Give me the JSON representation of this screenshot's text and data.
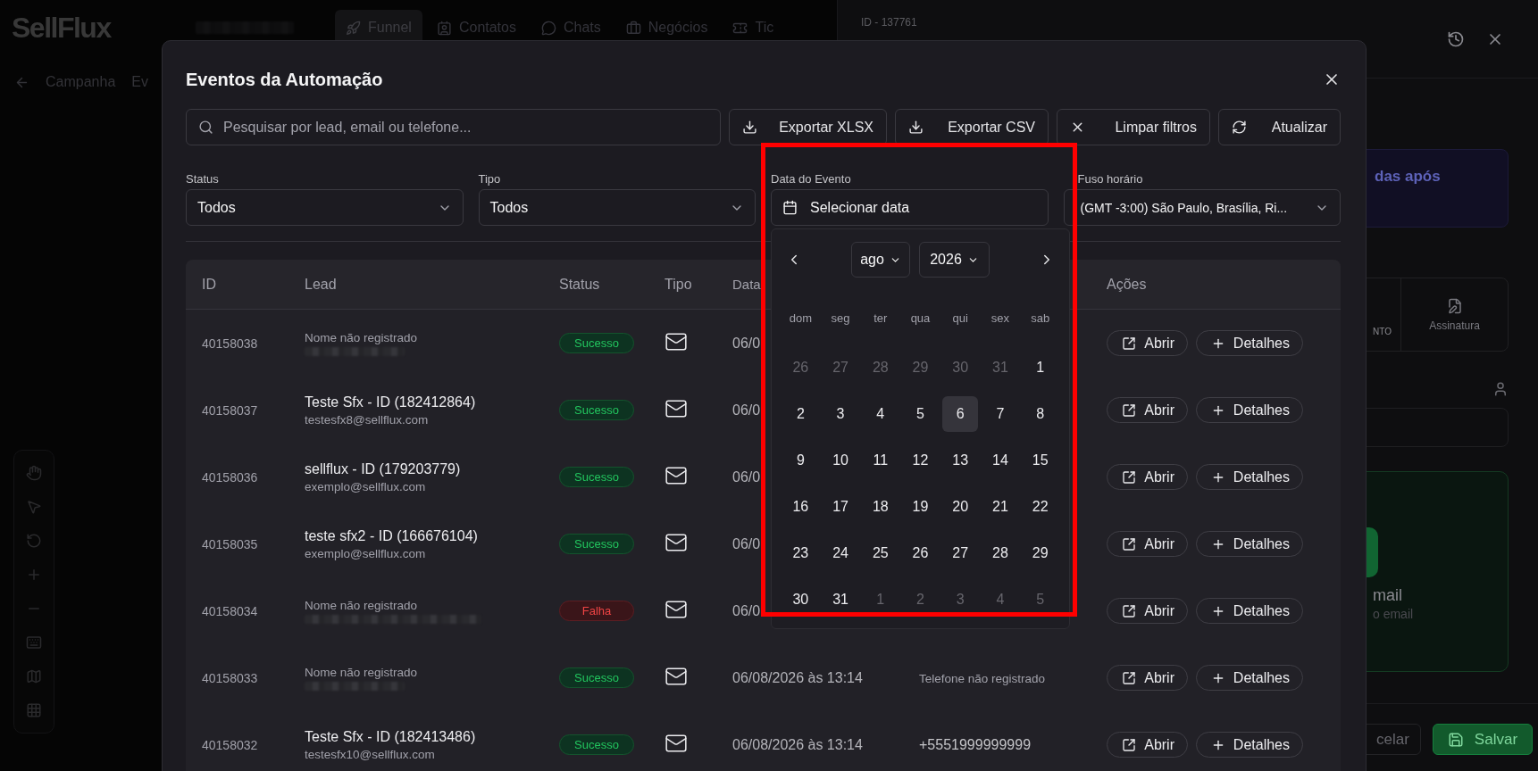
{
  "app": {
    "logo": "SellFlux",
    "nav": [
      {
        "label": "Funnel",
        "selected": true
      },
      {
        "label": "Contatos",
        "selected": false
      },
      {
        "label": "Chats",
        "selected": false
      },
      {
        "label": "Negócios",
        "selected": false
      },
      {
        "label": "Tic",
        "selected": false
      }
    ],
    "breadcrumb": [
      "Campanha",
      "Ev"
    ]
  },
  "drawer": {
    "title": "ID - 137761",
    "notice": "das após",
    "option_fragment": "NTO",
    "option": "Assinatura",
    "email_card": {
      "title": "mail",
      "subtitle": "o email"
    },
    "buttons": [
      {
        "kind": "cancel",
        "label": "celar"
      },
      {
        "kind": "save",
        "label": "Salvar"
      }
    ]
  },
  "modal": {
    "title": "Eventos da Automação",
    "search": {
      "placeholder": "Pesquisar por lead, email ou telefone..."
    },
    "actions": [
      {
        "kind": "download",
        "label": "Exportar XLSX"
      },
      {
        "kind": "download",
        "label": "Exportar CSV"
      },
      {
        "kind": "clear",
        "label": "Limpar filtros"
      },
      {
        "kind": "refresh",
        "label": "Atualizar"
      }
    ],
    "filters": [
      {
        "kind": "select",
        "label": "Status",
        "value": "Todos"
      },
      {
        "kind": "select",
        "label": "Tipo",
        "value": "Todos"
      },
      {
        "kind": "date",
        "label": "Data do Evento",
        "placeholder": "Selecionar data"
      },
      {
        "kind": "select",
        "label": "Fuso horário",
        "value": "(GMT -3:00) São Paulo, Brasília, Ri..."
      }
    ],
    "calendar": {
      "month": "ago",
      "year": "2026",
      "weekdays": [
        "dom",
        "seg",
        "ter",
        "qua",
        "qui",
        "sex",
        "sab"
      ],
      "weeks": [
        [
          {
            "day": "26",
            "outside": true,
            "selected": false
          },
          {
            "day": "27",
            "outside": true,
            "selected": false
          },
          {
            "day": "28",
            "outside": true,
            "selected": false
          },
          {
            "day": "29",
            "outside": true,
            "selected": false
          },
          {
            "day": "30",
            "outside": true,
            "selected": false
          },
          {
            "day": "31",
            "outside": true,
            "selected": false
          },
          {
            "day": "1",
            "outside": false,
            "selected": false
          }
        ],
        [
          {
            "day": "2",
            "outside": false,
            "selected": false
          },
          {
            "day": "3",
            "outside": false,
            "selected": false
          },
          {
            "day": "4",
            "outside": false,
            "selected": false
          },
          {
            "day": "5",
            "outside": false,
            "selected": false
          },
          {
            "day": "6",
            "outside": false,
            "selected": true
          },
          {
            "day": "7",
            "outside": false,
            "selected": false
          },
          {
            "day": "8",
            "outside": false,
            "selected": false
          }
        ],
        [
          {
            "day": "9",
            "outside": false,
            "selected": false
          },
          {
            "day": "10",
            "outside": false,
            "selected": false
          },
          {
            "day": "11",
            "outside": false,
            "selected": false
          },
          {
            "day": "12",
            "outside": false,
            "selected": false
          },
          {
            "day": "13",
            "outside": false,
            "selected": false
          },
          {
            "day": "14",
            "outside": false,
            "selected": false
          },
          {
            "day": "15",
            "outside": false,
            "selected": false
          }
        ],
        [
          {
            "day": "16",
            "outside": false,
            "selected": false
          },
          {
            "day": "17",
            "outside": false,
            "selected": false
          },
          {
            "day": "18",
            "outside": false,
            "selected": false
          },
          {
            "day": "19",
            "outside": false,
            "selected": false
          },
          {
            "day": "20",
            "outside": false,
            "selected": false
          },
          {
            "day": "21",
            "outside": false,
            "selected": false
          },
          {
            "day": "22",
            "outside": false,
            "selected": false
          }
        ],
        [
          {
            "day": "23",
            "outside": false,
            "selected": false
          },
          {
            "day": "24",
            "outside": false,
            "selected": false
          },
          {
            "day": "25",
            "outside": false,
            "selected": false
          },
          {
            "day": "26",
            "outside": false,
            "selected": false
          },
          {
            "day": "27",
            "outside": false,
            "selected": false
          },
          {
            "day": "28",
            "outside": false,
            "selected": false
          },
          {
            "day": "29",
            "outside": false,
            "selected": false
          }
        ],
        [
          {
            "day": "30",
            "outside": false,
            "selected": false
          },
          {
            "day": "31",
            "outside": false,
            "selected": false
          },
          {
            "day": "1",
            "outside": true,
            "selected": false
          },
          {
            "day": "2",
            "outside": true,
            "selected": false
          },
          {
            "day": "3",
            "outside": true,
            "selected": false
          },
          {
            "day": "4",
            "outside": true,
            "selected": false
          },
          {
            "day": "5",
            "outside": true,
            "selected": false
          }
        ]
      ]
    },
    "table": {
      "columns": [
        {
          "kind": "id",
          "label": "ID"
        },
        {
          "kind": "lead",
          "label": "Lead"
        },
        {
          "kind": "status",
          "label": "Status"
        },
        {
          "kind": "type",
          "label": "Tipo"
        },
        {
          "kind": "date",
          "label": "Data"
        },
        {
          "kind": "actions",
          "label": "Ações"
        }
      ],
      "rows": [
        {
          "id": "40158038",
          "lead": {
            "kind": "placeholder",
            "name": "Nome não registrado",
            "email_hidden": true
          },
          "status": {
            "kind": "success",
            "label": "Sucesso"
          },
          "type": {
            "kind": "email"
          },
          "date": "06/0",
          "actions": [
            "Abrir",
            "Detalhes"
          ]
        },
        {
          "id": "40158037",
          "lead": {
            "kind": "name",
            "name": "Teste Sfx - ID (182412864)",
            "email": "testesfx8@sellflux.com"
          },
          "status": {
            "kind": "success",
            "label": "Sucesso"
          },
          "type": {
            "kind": "email"
          },
          "date": "06/0",
          "actions": [
            "Abrir",
            "Detalhes"
          ]
        },
        {
          "id": "40158036",
          "lead": {
            "kind": "name",
            "name": "sellflux - ID (179203779)",
            "email": "exemplo@sellflux.com"
          },
          "status": {
            "kind": "success",
            "label": "Sucesso"
          },
          "type": {
            "kind": "email"
          },
          "date": "06/0",
          "actions": [
            "Abrir",
            "Detalhes"
          ]
        },
        {
          "id": "40158035",
          "lead": {
            "kind": "name",
            "name": "teste sfx2 - ID (166676104)",
            "email": "exemplo@sellflux.com"
          },
          "status": {
            "kind": "success",
            "label": "Sucesso"
          },
          "type": {
            "kind": "email"
          },
          "date": "06/0",
          "actions": [
            "Abrir",
            "Detalhes"
          ]
        },
        {
          "id": "40158034",
          "lead": {
            "kind": "placeholder",
            "name": "Nome não registrado",
            "email_hidden": true
          },
          "status": {
            "kind": "failure",
            "label": "Falha"
          },
          "type": {
            "kind": "email"
          },
          "date": "06/0",
          "actions": [
            "Abrir",
            "Detalhes"
          ]
        },
        {
          "id": "40158033",
          "lead": {
            "kind": "placeholder",
            "name": "Nome não registrado",
            "email_hidden": true
          },
          "status": {
            "kind": "success",
            "label": "Sucesso"
          },
          "type": {
            "kind": "email"
          },
          "date": "06/08/2026 às 13:14",
          "phone": {
            "kind": "placeholder",
            "text": "Telefone não registrado"
          },
          "actions": [
            "Abrir",
            "Detalhes"
          ]
        },
        {
          "id": "40158032",
          "lead": {
            "kind": "name",
            "name": "Teste Sfx - ID (182413486)",
            "email": "testesfx10@sellflux.com"
          },
          "status": {
            "kind": "success",
            "label": "Sucesso"
          },
          "type": {
            "kind": "email"
          },
          "date": "06/08/2026 às 13:14",
          "phone": {
            "kind": "value",
            "text": "+5551999999999"
          },
          "actions": [
            "Abrir",
            "Detalhes"
          ]
        }
      ]
    }
  }
}
